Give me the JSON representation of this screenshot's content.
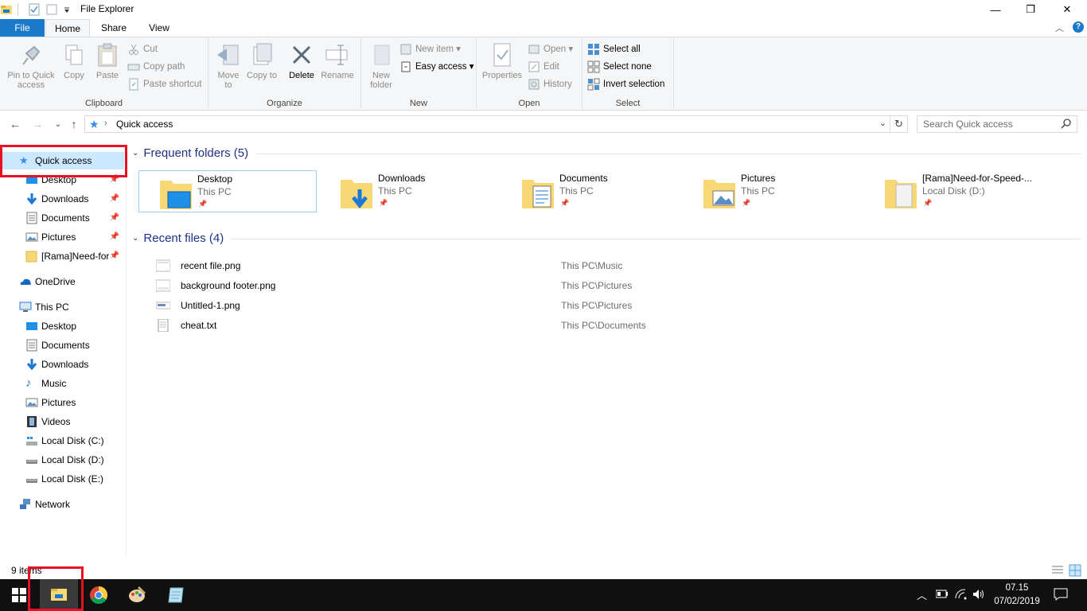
{
  "window": {
    "title": "File Explorer",
    "minimize_glyph": "—",
    "maximize_glyph": "❐",
    "close_glyph": "✕"
  },
  "ribbon": {
    "tabs": [
      "File",
      "Home",
      "Share",
      "View"
    ],
    "clipboard": {
      "label": "Clipboard",
      "pin": "Pin to Quick access",
      "copy": "Copy",
      "paste": "Paste",
      "cut": "Cut",
      "copy_path": "Copy path",
      "paste_shortcut": "Paste shortcut"
    },
    "organize": {
      "label": "Organize",
      "move_to": "Move to",
      "copy_to": "Copy to",
      "delete": "Delete",
      "rename": "Rename"
    },
    "new": {
      "label": "New",
      "new_folder": "New folder",
      "new_item": "New item",
      "easy_access": "Easy access"
    },
    "open": {
      "label": "Open",
      "properties": "Properties",
      "open": "Open",
      "edit": "Edit",
      "history": "History"
    },
    "select": {
      "label": "Select",
      "select_all": "Select all",
      "select_none": "Select none",
      "invert": "Invert selection"
    }
  },
  "address": {
    "path": "Quick access",
    "search_placeholder": "Search Quick access"
  },
  "nav": {
    "quick_access": "Quick access",
    "pinned": [
      "Desktop",
      "Downloads",
      "Documents",
      "Pictures",
      "[Rama]Need-for"
    ],
    "onedrive": "OneDrive",
    "this_pc": "This PC",
    "pc_items": [
      "Desktop",
      "Documents",
      "Downloads",
      "Music",
      "Pictures",
      "Videos",
      "Local Disk (C:)",
      "Local Disk (D:)",
      "Local Disk (E:)"
    ],
    "network": "Network"
  },
  "content": {
    "frequent_header": "Frequent folders (5)",
    "recent_header": "Recent files (4)",
    "folders": [
      {
        "name": "Desktop",
        "location": "This PC"
      },
      {
        "name": "Downloads",
        "location": "This PC"
      },
      {
        "name": "Documents",
        "location": "This PC"
      },
      {
        "name": "Pictures",
        "location": "This PC"
      },
      {
        "name": "[Rama]Need-for-Speed-...",
        "location": "Local Disk (D:)"
      }
    ],
    "files": [
      {
        "name": "recent file.png",
        "path": "This PC\\Music"
      },
      {
        "name": "background footer.png",
        "path": "This PC\\Pictures"
      },
      {
        "name": "Untitled-1.png",
        "path": "This PC\\Pictures"
      },
      {
        "name": "cheat.txt",
        "path": "This PC\\Documents"
      }
    ]
  },
  "status": {
    "item_count": "9 items"
  },
  "taskbar": {
    "time": "07.15",
    "date": "07/02/2019"
  },
  "colors": {
    "accent": "#1979ca",
    "selection": "#cce8ff",
    "annotation_red": "#e81123",
    "folder_yellow": "#f8d775"
  }
}
